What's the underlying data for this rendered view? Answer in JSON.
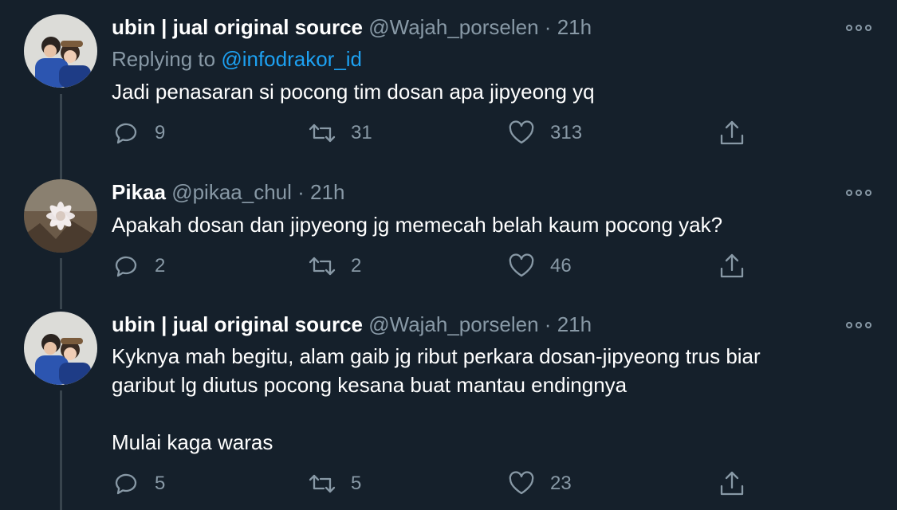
{
  "tweets": [
    {
      "name": "ubin | jual original source",
      "handle": "@Wajah_porselen",
      "separator": "·",
      "time": "21h",
      "replying_label": "Replying to",
      "replying_handle": "@infodrakor_id",
      "text_lines": [
        "Jadi penasaran si pocong tim dosan apa jipyeong yq"
      ],
      "counts": {
        "replies": "9",
        "retweets": "31",
        "likes": "313"
      },
      "avatar_icon": "profile-photo-couple"
    },
    {
      "name": "Pikaa",
      "handle": "@pikaa_chul",
      "separator": "·",
      "time": "21h",
      "text_lines": [
        "Apakah dosan dan jipyeong jg memecah belah kaum pocong yak?"
      ],
      "counts": {
        "replies": "2",
        "retweets": "2",
        "likes": "46"
      },
      "avatar_icon": "profile-photo-flower"
    },
    {
      "name": "ubin | jual original source",
      "handle": "@Wajah_porselen",
      "separator": "·",
      "time": "21h",
      "text_lines": [
        "Kyknya mah begitu, alam gaib jg ribut perkara dosan-jipyeong trus biar",
        "garibut lg diutus pocong kesana buat mantau endingnya",
        "",
        "Mulai kaga waras"
      ],
      "counts": {
        "replies": "5",
        "retweets": "5",
        "likes": "23"
      },
      "avatar_icon": "profile-photo-couple"
    }
  ],
  "colors": {
    "background": "#15202b",
    "text": "#ffffff",
    "muted": "#8899a6",
    "link": "#1da1f2",
    "thread_line": "#38444d"
  }
}
